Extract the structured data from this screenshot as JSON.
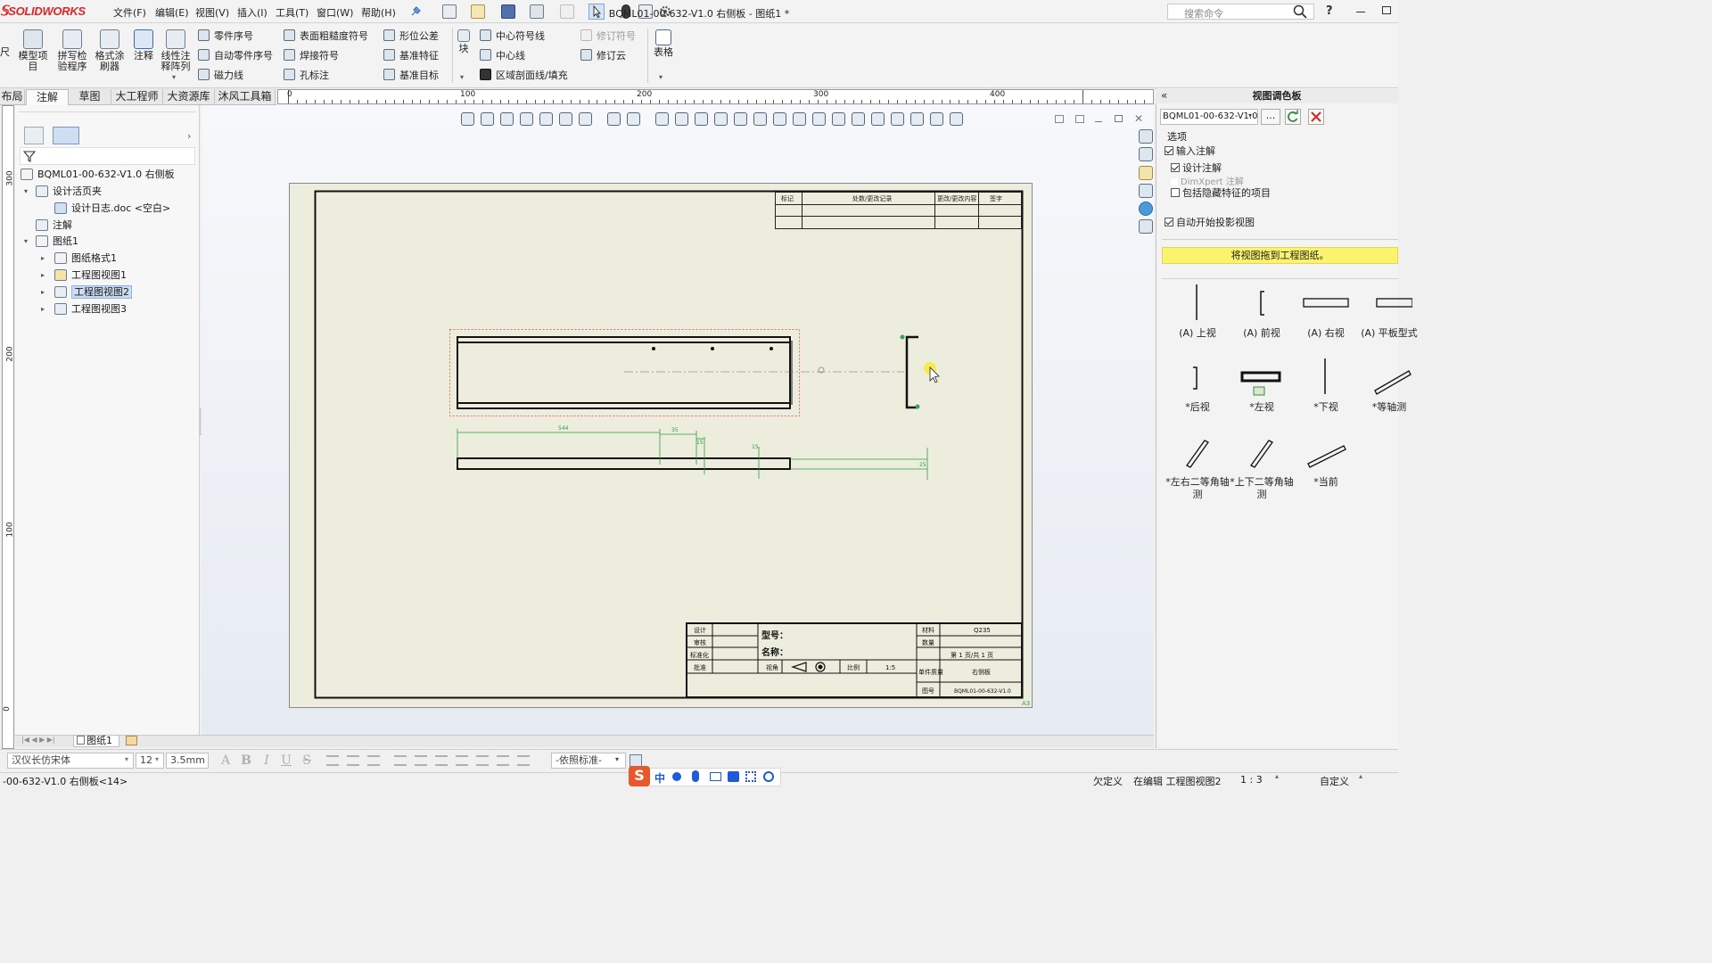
{
  "app": {
    "logo": "SOLIDWORKS",
    "document_title": "BQML01-00-632-V1.0 右侧板 - 图纸1 *",
    "menu": [
      "文件(F)",
      "编辑(E)",
      "视图(V)",
      "插入(I)",
      "工具(T)",
      "窗口(W)",
      "帮助(H)"
    ],
    "search_placeholder": "搜索命令",
    "help_label": "?"
  },
  "commandmanager": {
    "left_partial": "尺",
    "big_buttons": [
      {
        "name": "model-items",
        "label": "模型项目"
      },
      {
        "name": "spell-checker",
        "label": "拼写检验程序"
      },
      {
        "name": "format-painter",
        "label": "格式涂刷器"
      },
      {
        "name": "note",
        "label": "注释"
      },
      {
        "name": "linear-note-pattern",
        "label": "线性注释阵列"
      }
    ],
    "col1": [
      "零件序号",
      "自动零件序号",
      "磁力线"
    ],
    "col2": [
      "表面粗糙度符号",
      "焊接符号",
      "孔标注"
    ],
    "col3": [
      "形位公差",
      "基准特征",
      "基准目标"
    ],
    "block_label": "块",
    "col4": [
      "中心符号线",
      "中心线",
      "区域剖面线/填充"
    ],
    "col5": [
      "修订符号",
      "修订云"
    ],
    "table_label": "表格"
  },
  "tabs": [
    "布局",
    "注解",
    "草图",
    "大工程师",
    "大资源库",
    "沐风工具箱"
  ],
  "active_tab": 1,
  "ruler_h": [
    "0",
    "100",
    "200",
    "300",
    "400"
  ],
  "ruler_v": [
    "300",
    "200",
    "100",
    "0"
  ],
  "tree": {
    "root": "BQML01-00-632-V1.0 右侧板",
    "items": [
      {
        "label": "设计活页夹",
        "level": 1,
        "expanded": true
      },
      {
        "label": "设计日志.doc <空白>",
        "level": 2
      },
      {
        "label": "注解",
        "level": 1
      },
      {
        "label": "图纸1",
        "level": 1,
        "expanded": true
      },
      {
        "label": "图纸格式1",
        "level": 2
      },
      {
        "label": "工程图视图1",
        "level": 2
      },
      {
        "label": "工程图视图2",
        "level": 2,
        "selected": true
      },
      {
        "label": "工程图视图3",
        "level": 2
      }
    ]
  },
  "drawing": {
    "revision_headers": [
      "标记",
      "处数/更改记录",
      "更改/更改内容",
      "签字"
    ],
    "dimensions": [
      "544",
      "35",
      "15",
      "15",
      "25"
    ],
    "titleblock": {
      "left_labels": [
        "设计",
        "审核",
        "标准化",
        "批准"
      ],
      "model_label": "型号：",
      "name_label": "名称：",
      "projection_label": "视角",
      "scale_label": "比例",
      "scale_value": "1:5",
      "material_label": "材料",
      "material_value": "Q235",
      "qty_label": "数量",
      "sheet_info": "第 1 页/共 1 页",
      "unit_label": "单件质量",
      "unit_value": "右侧板",
      "drawing_no_label": "图号",
      "drawing_no_value": "BQML01-00-632-V1.0",
      "corner_mark": "A3"
    }
  },
  "view_palette": {
    "title": "视图调色板",
    "document": "BQML01-00-632-V1.0",
    "browse_label": "...",
    "options_label": "选项",
    "options": [
      {
        "label": "输入注解",
        "checked": true,
        "indent": 0
      },
      {
        "label": "设计注解",
        "checked": true,
        "indent": 1
      },
      {
        "label": "DimXpert 注解",
        "checked": false,
        "indent": 1,
        "disabled": true
      },
      {
        "label": "包括隐藏特征的项目",
        "checked": false,
        "indent": 1
      }
    ],
    "auto_projection": "自动开始投影视图",
    "hint": "将视图拖到工程图纸。",
    "views": [
      "(A) 上视",
      "(A) 前视",
      "(A) 右视",
      "(A) 平板型式",
      "*后视",
      "*左视",
      "*下视",
      "*等轴测",
      "*左右二等角轴测",
      "*上下二等角轴测",
      "*当前"
    ]
  },
  "sheet_tab": "图纸1",
  "format_bar": {
    "font": "汉仪长仿宋体",
    "size": "12",
    "height": "3.5mm",
    "style_buttons": [
      "A",
      "B",
      "I",
      "U",
      "S"
    ],
    "layer": "-依照标准-"
  },
  "status": {
    "left": "-00-632-V1.0 右侧板<14>",
    "underdefined": "欠定义",
    "editing": "在编辑 工程图视图2",
    "scale": "1 : 3",
    "custom": "自定义"
  },
  "ime": {
    "lang": "中"
  }
}
